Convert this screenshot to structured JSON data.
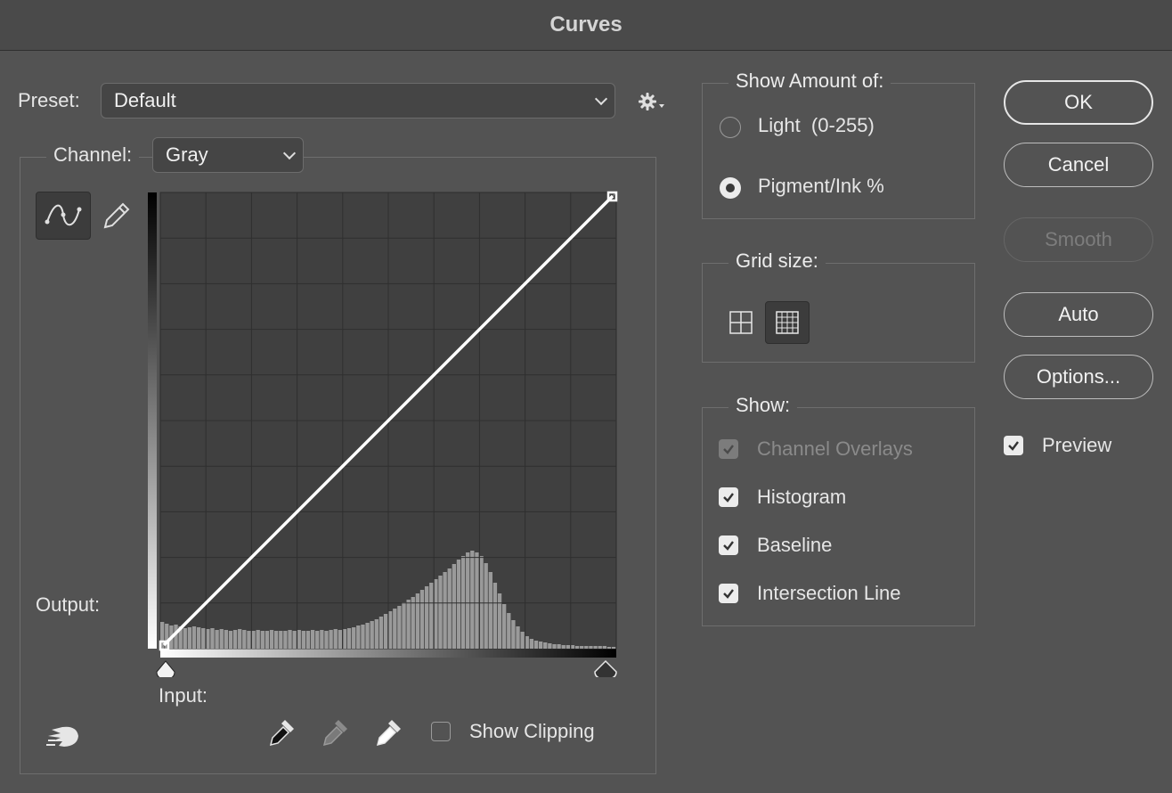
{
  "window": {
    "title": "Curves"
  },
  "preset": {
    "label": "Preset:",
    "value": "Default"
  },
  "channel": {
    "label": "Channel:",
    "value": "Gray"
  },
  "curve": {
    "output_label": "Output:",
    "input_label": "Input:",
    "grid_divisions": 10,
    "line_color": "#ffffff"
  },
  "histogram": [
    30,
    28,
    26,
    27,
    25,
    23,
    24,
    25,
    24,
    23,
    22,
    23,
    21,
    22,
    21,
    20,
    21,
    22,
    21,
    20,
    20,
    21,
    20,
    20,
    21,
    20,
    20,
    20,
    21,
    20,
    21,
    20,
    20,
    21,
    20,
    21,
    20,
    21,
    22,
    21,
    22,
    23,
    24,
    26,
    27,
    29,
    31,
    33,
    36,
    39,
    42,
    45,
    48,
    52,
    55,
    58,
    62,
    66,
    70,
    74,
    78,
    82,
    86,
    90,
    95,
    100,
    104,
    108,
    110,
    108,
    104,
    96,
    86,
    74,
    62,
    50,
    40,
    32,
    25,
    19,
    14,
    11,
    9,
    8,
    7,
    6,
    5,
    5,
    4,
    4,
    4,
    3,
    3,
    3,
    3,
    3,
    3,
    3,
    2,
    2
  ],
  "show_clipping": {
    "label": "Show Clipping",
    "checked": false
  },
  "show_amount": {
    "legend": "Show Amount of:",
    "light_label": "Light  (0-255)",
    "pigment_label": "Pigment/Ink %",
    "selected": "pigment"
  },
  "grid_size": {
    "legend": "Grid size:",
    "selected": "detailed"
  },
  "show": {
    "legend": "Show:",
    "channel_overlays": "Channel Overlays",
    "histogram": "Histogram",
    "baseline": "Baseline",
    "intersection_line": "Intersection Line"
  },
  "buttons": {
    "ok": "OK",
    "cancel": "Cancel",
    "smooth": "Smooth",
    "auto": "Auto",
    "options": "Options..."
  },
  "preview": {
    "label": "Preview",
    "checked": true
  }
}
